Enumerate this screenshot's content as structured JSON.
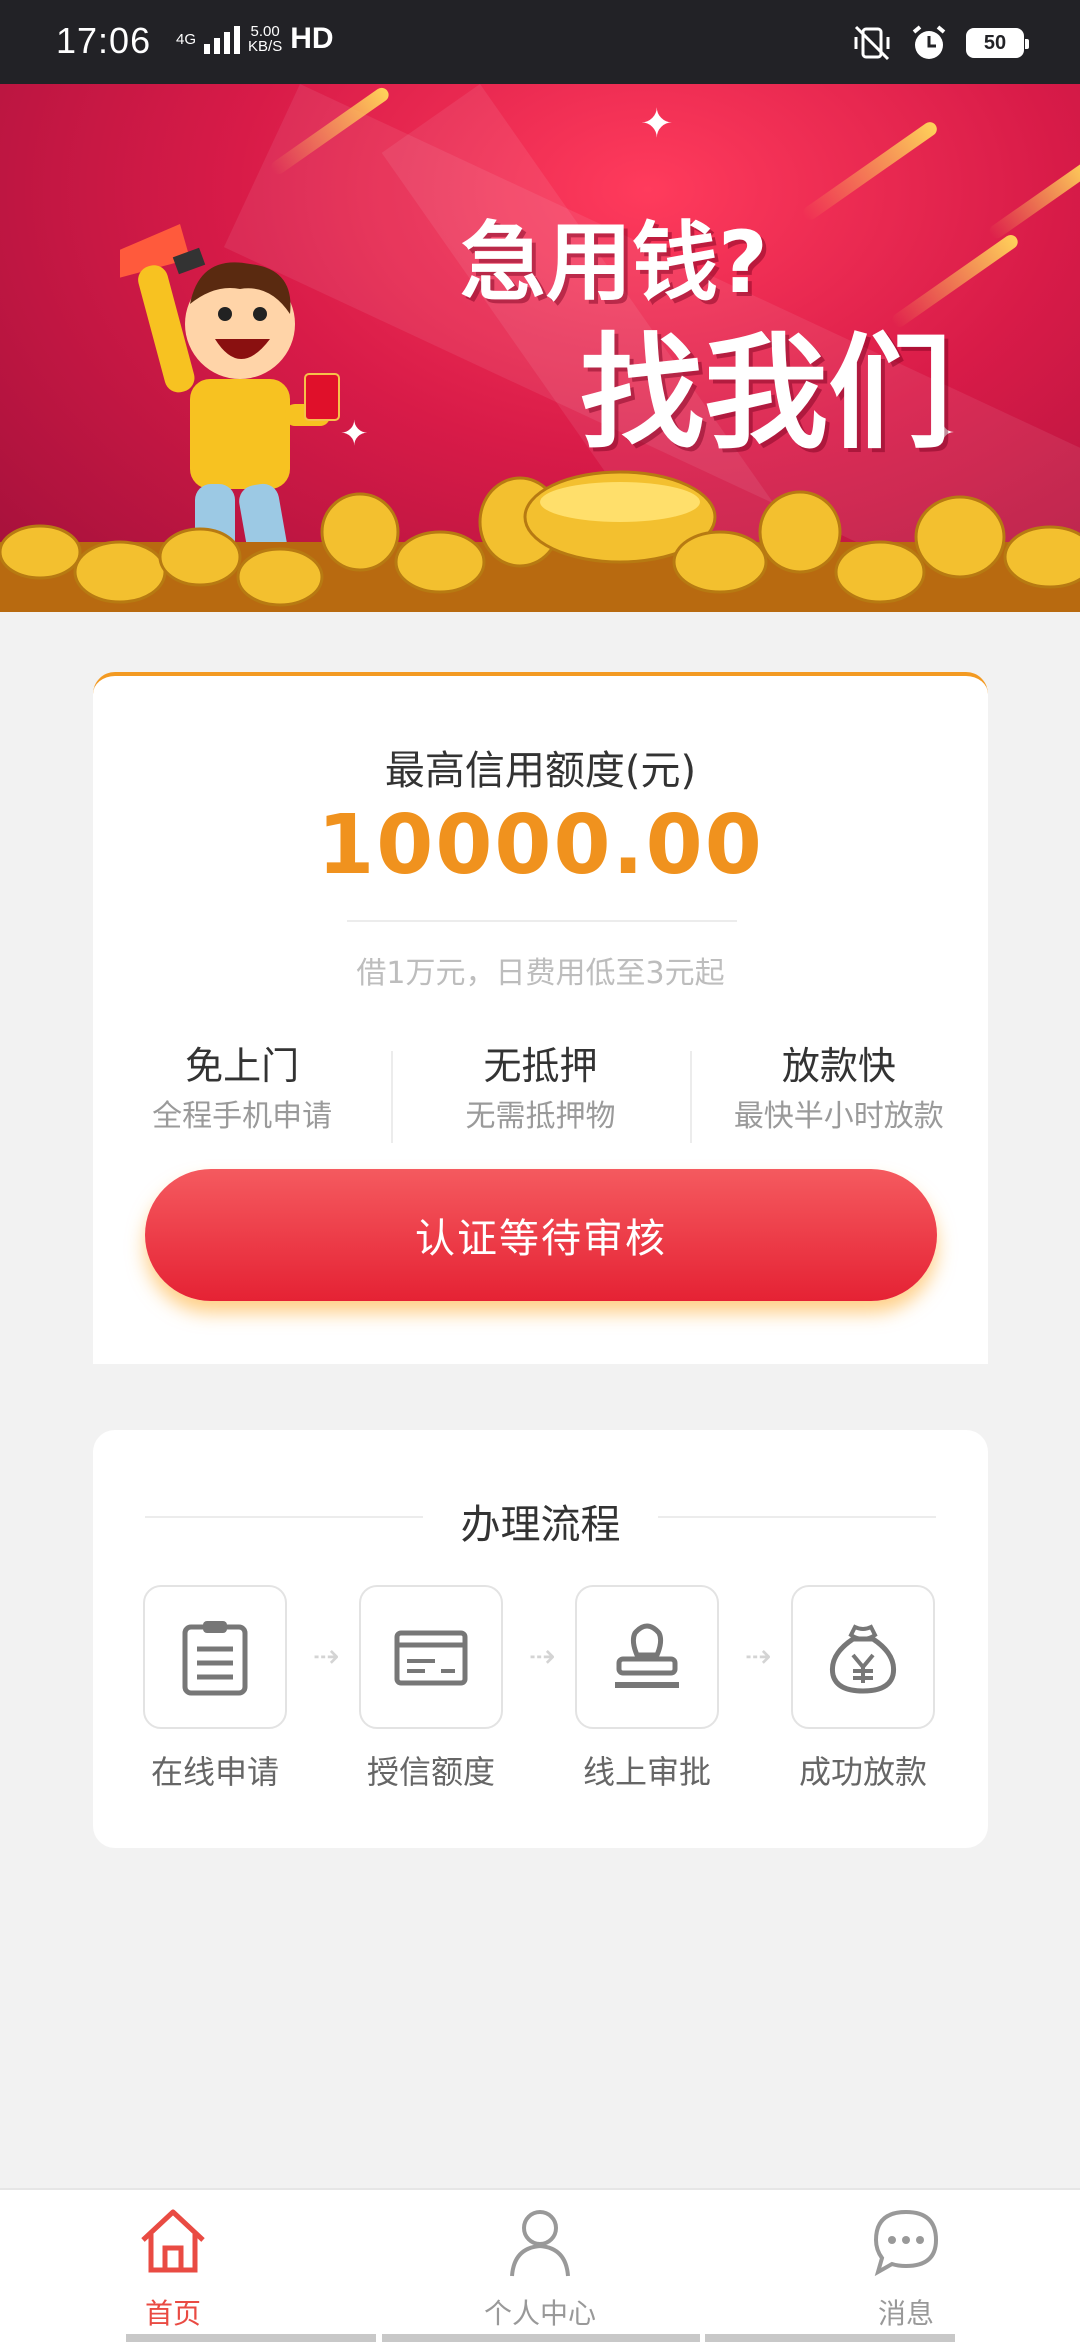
{
  "status_bar": {
    "time": "17:06",
    "network_type": "4G",
    "speed_value": "5.00",
    "speed_unit": "KB/S",
    "hd": "HD",
    "battery": "50"
  },
  "banner": {
    "headline_top": "急用钱?",
    "headline_bottom": "找我们"
  },
  "credit": {
    "title": "最高信用额度(元)",
    "amount": "10000.00",
    "subtitle": "借1万元，日费用低至3元起",
    "features": [
      {
        "title": "免上门",
        "subtitle": "全程手机申请"
      },
      {
        "title": "无抵押",
        "subtitle": "无需抵押物"
      },
      {
        "title": "放款快",
        "subtitle": "最快半小时放款"
      }
    ],
    "button_label": "认证等待审核"
  },
  "process": {
    "heading": "办理流程",
    "steps": [
      {
        "label": "在线申请",
        "icon": "clipboard-icon"
      },
      {
        "label": "授信额度",
        "icon": "card-icon"
      },
      {
        "label": "线上审批",
        "icon": "stamp-icon"
      },
      {
        "label": "成功放款",
        "icon": "money-bag-icon"
      }
    ]
  },
  "tabbar": {
    "items": [
      {
        "label": "首页",
        "icon": "home-icon",
        "active": true
      },
      {
        "label": "个人中心",
        "icon": "person-icon",
        "active": false
      },
      {
        "label": "消息",
        "icon": "chat-bubble-icon",
        "active": false
      }
    ]
  },
  "colors": {
    "accent_orange": "#f0921e",
    "button_red": "#e52234",
    "tab_active": "#e94b43",
    "tab_inactive": "#999999"
  }
}
